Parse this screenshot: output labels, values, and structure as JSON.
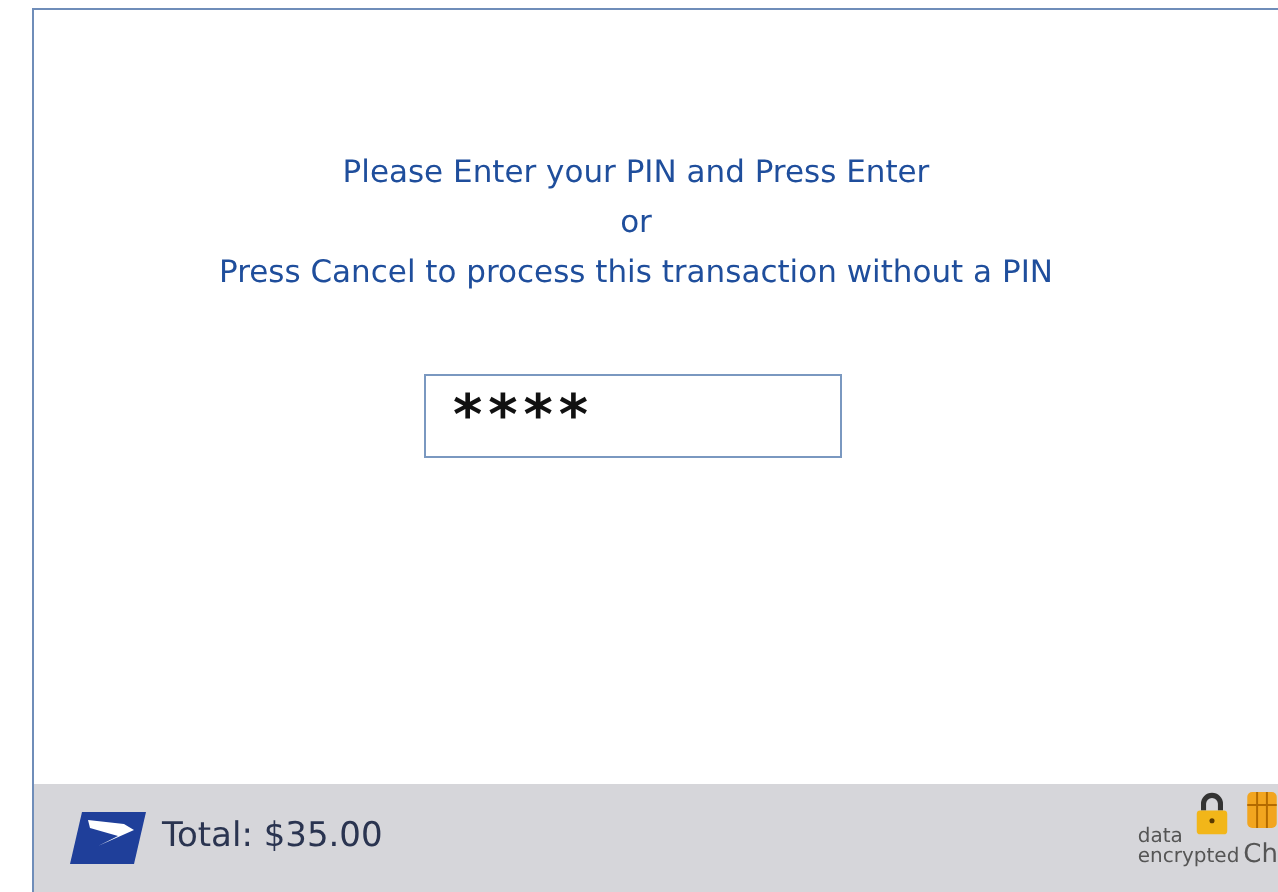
{
  "prompt": {
    "lines": [
      "Please Enter your PIN and Press Enter",
      "or",
      "Press Cancel to process this transaction without a PIN"
    ]
  },
  "pin_field": {
    "value": "****"
  },
  "footer": {
    "total": "Total: $35.00",
    "security_label": [
      "data",
      "encrypted"
    ],
    "chip_label": "Ch"
  }
}
